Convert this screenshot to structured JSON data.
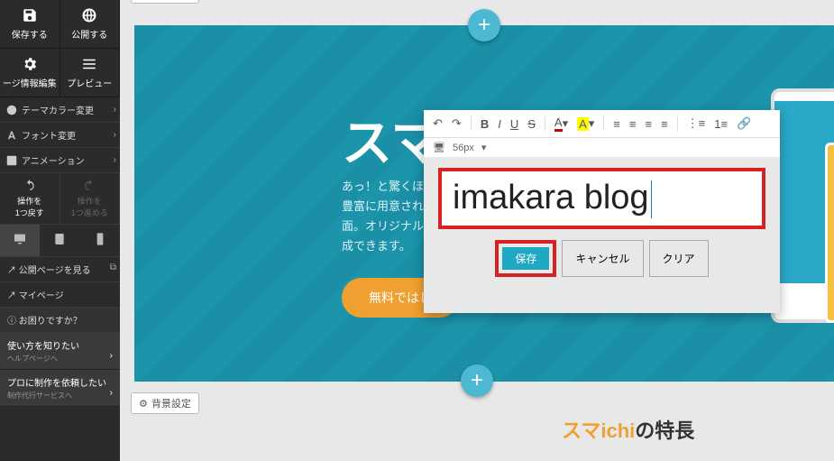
{
  "sidebar": {
    "save": "保存する",
    "publish": "公開する",
    "pageInfo": "ージ情報編集",
    "preview": "プレビュー",
    "themeColor": "テーマカラー変更",
    "font": "フォント変更",
    "animation": "アニメーション",
    "undo": {
      "label": "操作を",
      "sub": "1つ戻す"
    },
    "redo": {
      "label": "操作を",
      "sub": "1つ進める"
    },
    "viewPublic": "公開ページを見る",
    "mypage": "マイページ",
    "help": "お困りですか？",
    "howto": {
      "t1": "使い方を知りたい",
      "t2": "ヘルプページへ"
    },
    "pro": {
      "t1": "プロに制作を依頼したい",
      "t2": "制作代行サービスへ"
    }
  },
  "canvas": {
    "bgSetting": "背景設定",
    "heroTitlePartial": "スマi",
    "heroDesc1": "あっ！と驚くほど",
    "heroDesc2": "豊富に用意された",
    "heroDesc3": "面。オリジナルホ",
    "heroDesc4": "成できます。",
    "cta": "無料ではじ",
    "section2": {
      "part1": "スマichi",
      "part2": "の特長"
    }
  },
  "editor": {
    "toolbar": {
      "undo": "↶",
      "redo": "↷",
      "bold": "B",
      "italic": "I",
      "underline": "U",
      "strike": "S",
      "fontColor": "A",
      "bgColor": "A",
      "fontSizeLabel": "56px"
    },
    "text": "imakara blog",
    "save": "保存",
    "cancel": "キャンセル",
    "clear": "クリア"
  }
}
